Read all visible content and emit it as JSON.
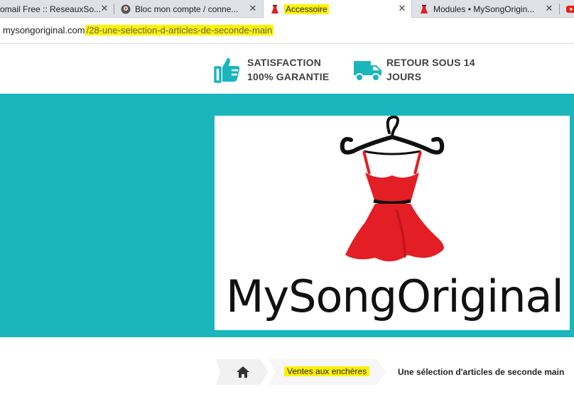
{
  "browser": {
    "tabs": [
      {
        "label": "omail Free :: ReseauxSo...",
        "active": false
      },
      {
        "label": "Bloc mon compte / conne...",
        "active": false
      },
      {
        "label": "Accessoire",
        "active": true
      },
      {
        "label": "Modules • MySongOrigin...",
        "active": false
      }
    ],
    "close_glyph": "✕",
    "url_domain": "mysongoriginal.com",
    "url_path": "/28-une-selection-d-articles-de-seconde-main"
  },
  "reassurance": [
    {
      "line1": "SATISFACTION",
      "line2": "100% GARANTIE",
      "icon": "thumbs-up-icon"
    },
    {
      "line1": "RETOUR SOUS 14",
      "line2": "JOURS",
      "icon": "truck-icon"
    }
  ],
  "logo": {
    "text": "MySongOriginal"
  },
  "breadcrumb": {
    "home_icon": "home-icon",
    "middle": "Ventes aux enchères",
    "current": "Une sélection d'articles de seconde main"
  },
  "colors": {
    "banner": "#1ab5bd",
    "icon_teal": "#1ab5bd",
    "dress_red": "#e31e24",
    "highlight": "#fff200"
  }
}
